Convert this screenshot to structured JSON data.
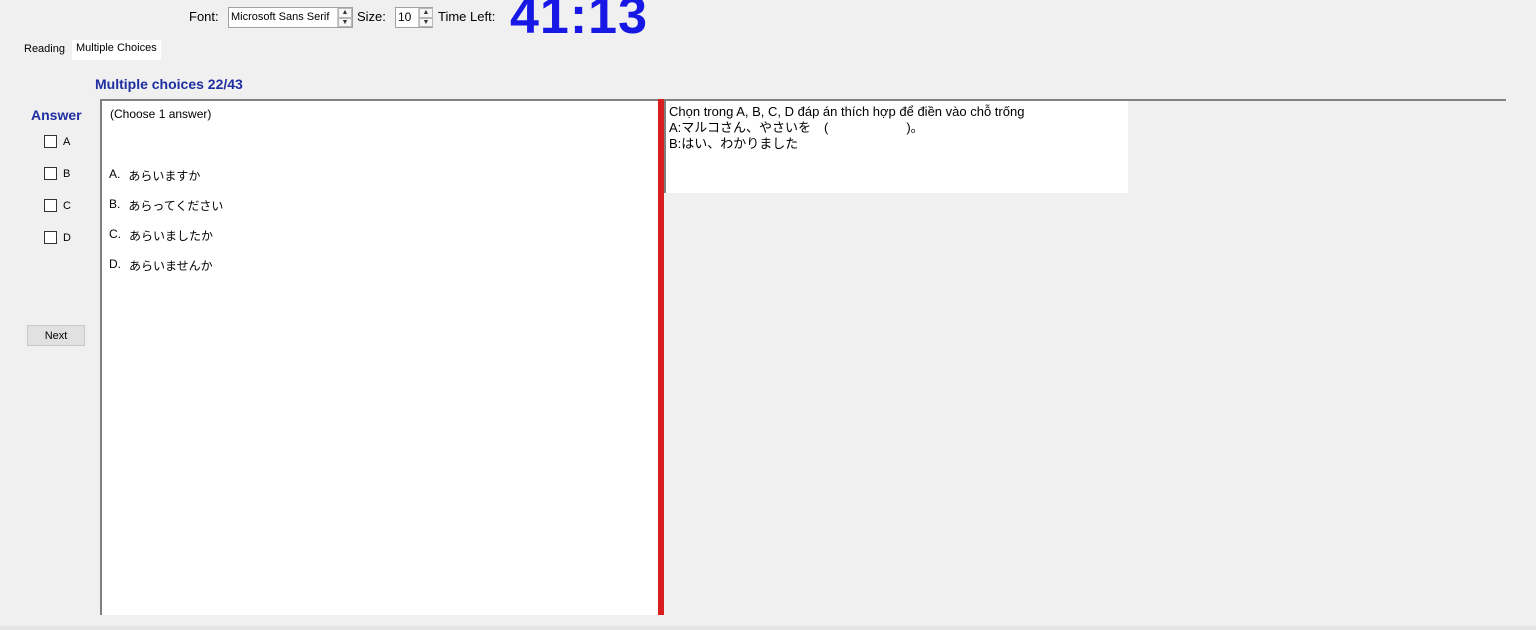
{
  "toolbar": {
    "font_label": "Font:",
    "font_value": "Microsoft Sans Serif",
    "size_label": "Size:",
    "size_value": "10",
    "time_label": "Time Left:",
    "time_value": "41:13"
  },
  "tabs": [
    {
      "label": "Reading",
      "active": false
    },
    {
      "label": "Multiple Choices",
      "active": true
    }
  ],
  "header": {
    "title": "Multiple choices 22/43"
  },
  "answer": {
    "label": "Answer",
    "options": [
      "A",
      "B",
      "C",
      "D"
    ],
    "next_label": "Next"
  },
  "question": {
    "instruction": "(Choose 1 answer)",
    "options": [
      {
        "letter": "A.",
        "text": "あらいますか"
      },
      {
        "letter": "B.",
        "text": "あらってください"
      },
      {
        "letter": "C.",
        "text": "あらいましたか"
      },
      {
        "letter": "D.",
        "text": "あらいませんか"
      }
    ]
  },
  "reading": {
    "lines": [
      "Chọn trong A, B, C, D đáp án thích hợp để điền vào chỗ trống",
      "A:マルコさん、やさいを　(　　　　　　)。",
      "B:はい、わかりました"
    ]
  },
  "colors": {
    "timer": "#1717e6",
    "title": "#1e2ea0",
    "splitter": "#d81e1e"
  }
}
